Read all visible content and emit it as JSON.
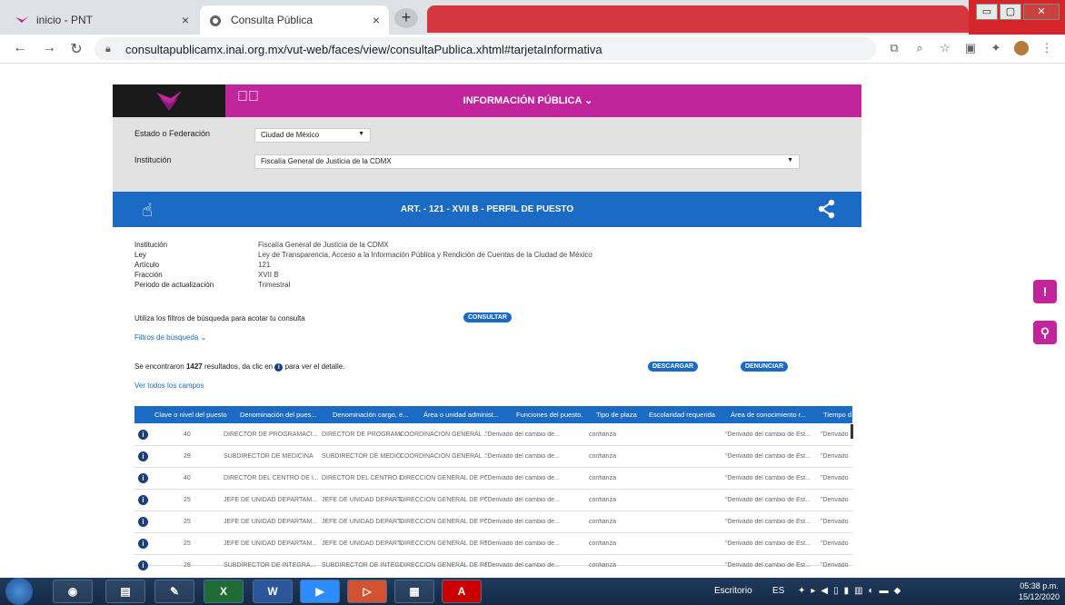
{
  "browser": {
    "tabs": [
      {
        "title": "inicio - PNT"
      },
      {
        "title": "Consulta Pública"
      }
    ],
    "url": "consultapublicamx.inai.org.mx/vut-web/faces/view/consultaPublica.xhtml#tarjetaInformativa"
  },
  "header": {
    "menu_label": "INFORMACIÓN PÚBLICA ⌄"
  },
  "filters": {
    "estado_label": "Estado o Federación",
    "estado_value": "Ciudad de México",
    "institucion_label": "Institución",
    "institucion_value": "Fiscalía General de Justicia de la CDMX"
  },
  "band": {
    "title": "ART. - 121 - XVII B - PERFIL DE PUESTO"
  },
  "details": [
    {
      "label": "Institución",
      "value": "Fiscalía General de Justicia de la CDMX"
    },
    {
      "label": "Ley",
      "value": "Ley de Transparencia, Acceso a la Información Pública y Rendición de Cuentas de la Ciudad de México"
    },
    {
      "label": "Artículo",
      "value": "121"
    },
    {
      "label": "Fracción",
      "value": "XVII B"
    },
    {
      "label": "Periodo de actualización",
      "value": "Trimestral"
    }
  ],
  "search": {
    "hint": "Utiliza los filtros de búsqueda para acotar tu consulta",
    "consultar": "CONSULTAR",
    "filtros": "Filtros de búsqueda ⌄"
  },
  "results": {
    "prefix": "Se encontraron",
    "count": "1427",
    "suffix": "resultados, da clic en",
    "suffix2": "para ver el detalle.",
    "descargar": "DESCARGAR",
    "denunciar": "DENUNCIAR",
    "ver_todos": "Ver todos los campos"
  },
  "table": {
    "columns": [
      "Clave o nivel del puesto",
      "Denominación del pues...",
      "Denominación cargo, e...",
      "Área o unidad administ...",
      "Funciones del puesto.",
      "Tipo de plaza",
      "Escolaridad requerida",
      "Área de conocimiento r...",
      "Tiempo d"
    ],
    "rows": [
      [
        "40",
        "DIRECTOR DE PROGRAMACI...",
        "DIRECTOR DE PROGRAMACI...",
        "COORDINACION GENERAL ...",
        "\"Derivado del cambio de...",
        "confianza",
        "",
        "\"Derivado del cambio de Est...",
        "\"Derivado"
      ],
      [
        "29",
        "SUBDIRECTOR DE MEDICINA",
        "SUBDIRECTOR DE MEDICINA",
        "COORDINACION GENERAL ...",
        "\"Derivado del cambio de...",
        "confianza",
        "",
        "\"Derivado del cambio de Est...",
        "\"Derivado"
      ],
      [
        "40",
        "DIRECTOR DEL CENTRO DE I...",
        "DIRECTOR DEL CENTRO DE I...",
        "DIRECCION GENERAL DE PO...",
        "\"Derivado del cambio de...",
        "confianza",
        "",
        "\"Derivado del cambio de Est...",
        "\"Derivado"
      ],
      [
        "25",
        "JEFE DE UNIDAD DEPARTAM...",
        "JEFE DE UNIDAD DEPARTAM...",
        "DIRECCION GENERAL DE PO...",
        "\"Derivado del cambio de...",
        "confianza",
        "",
        "\"Derivado del cambio de Est...",
        "\"Derivado"
      ],
      [
        "25",
        "JEFE DE UNIDAD DEPARTAM...",
        "JEFE DE UNIDAD DEPARTAM...",
        "DIRECCION GENERAL DE PO...",
        "\"Derivado del cambio de...",
        "confianza",
        "",
        "\"Derivado del cambio de Est...",
        "\"Derivado"
      ],
      [
        "25",
        "JEFE DE UNIDAD DEPARTAM...",
        "JEFE DE UNIDAD DEPARTAM...",
        "DIRECCION GENERAL DE RE...",
        "\"Derivado del cambio de...",
        "confianza",
        "",
        "\"Derivado del cambio de Est...",
        "\"Derivado"
      ],
      [
        "29",
        "SUBDIRECTOR DE INTEGRA...",
        "SUBDIRECTOR DE INTEGRA...",
        "DIRECCION GENERAL DE RE...",
        "\"Derivado del cambio de...",
        "confianza",
        "",
        "\"Derivado del cambio de Est...",
        "\"Derivado"
      ]
    ]
  },
  "taskbar": {
    "escritorio": "Escritorio",
    "lang": "ES",
    "time": "05:38 p.m.",
    "date": "15/12/2020"
  },
  "colors": {
    "magenta": "#c2259b",
    "blue": "#1b6ac4"
  }
}
